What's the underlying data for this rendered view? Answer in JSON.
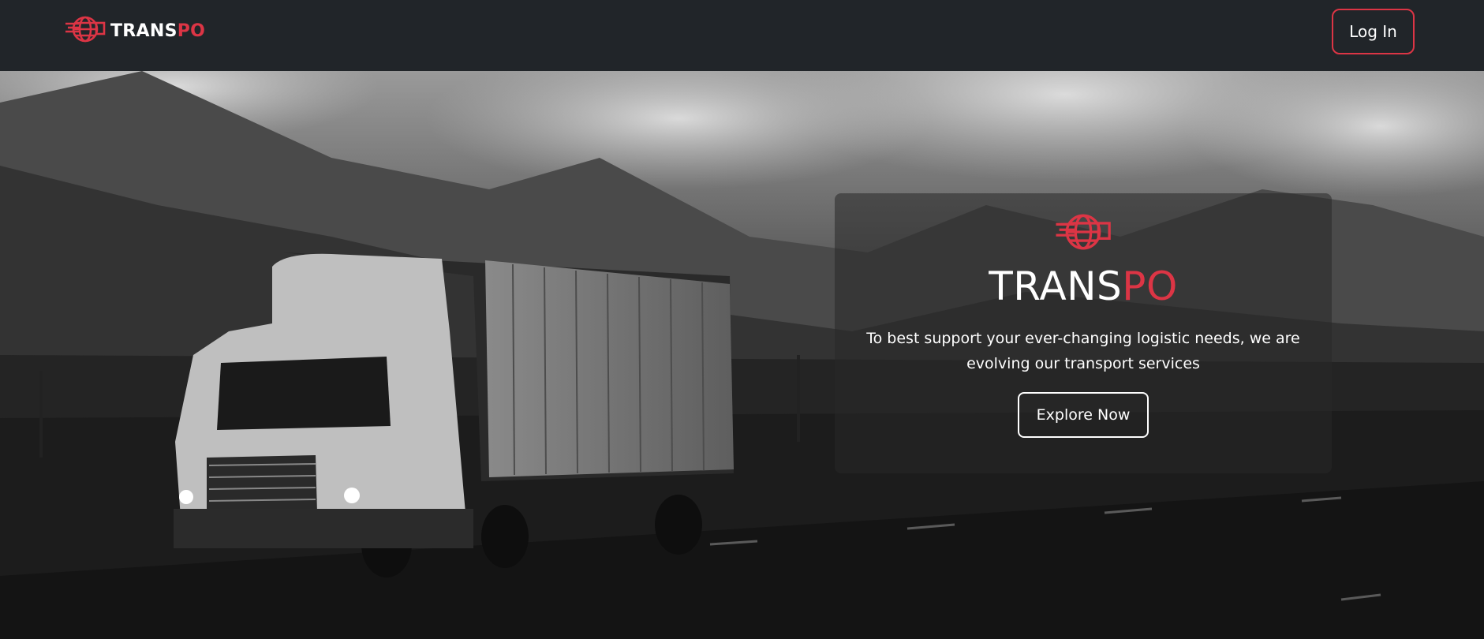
{
  "navbar": {
    "brand": {
      "part1": "TRANS",
      "part2": "PO",
      "icon": "globe-truck-logo-icon"
    },
    "login_label": "Log In"
  },
  "hero": {
    "background": "truck-on-highway-mountains-photo",
    "card": {
      "icon": "globe-truck-logo-icon",
      "title_part1": "TRANS",
      "title_part2": "PO",
      "text": "To best support your ever-changing logistic needs, we are evolving our transport services",
      "button_label": "Explore Now"
    }
  },
  "colors": {
    "accent": "#dc3545",
    "navbar_bg": "#212529",
    "text": "#ffffff"
  }
}
